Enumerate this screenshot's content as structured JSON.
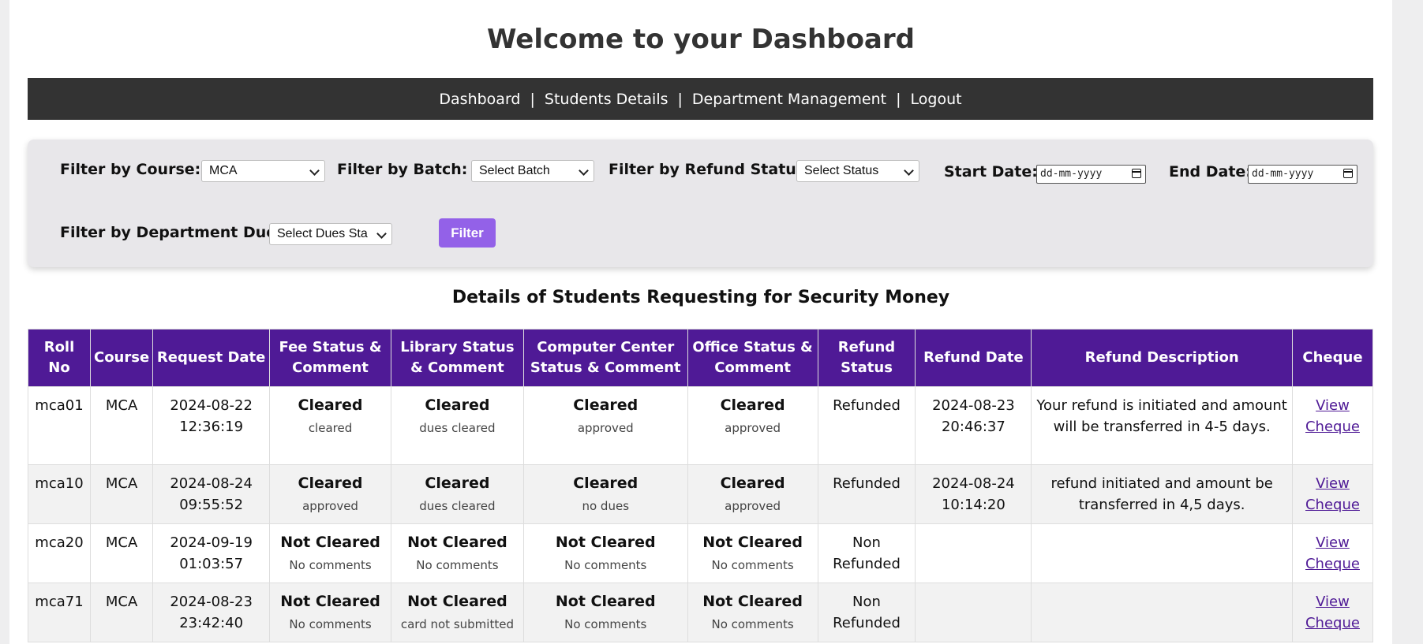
{
  "header": {
    "title": "Welcome to your Dashboard"
  },
  "nav": {
    "items": [
      "Dashboard",
      "Students Details",
      "Department Management",
      "Logout"
    ],
    "separator": "|"
  },
  "filters": {
    "course": {
      "label": "Filter by Course:",
      "value": "MCA"
    },
    "batch": {
      "label": "Filter by Batch:",
      "value": "Select Batch"
    },
    "refund_status": {
      "label": "Filter by Refund Status:",
      "value": "Select Status"
    },
    "start_date": {
      "label": "Start Date:",
      "placeholder": "dd-mm-yyyy"
    },
    "end_date": {
      "label": "End Date:",
      "placeholder": "dd-mm-yyyy"
    },
    "dues": {
      "label": "Filter by Department Dues:",
      "value": "Select Dues Sta"
    },
    "button_label": "Filter"
  },
  "section_title": "Details of Students Requesting for Security Money",
  "table": {
    "headers": [
      "Roll No",
      "Course",
      "Request Date",
      "Fee Status & Comment",
      "Library Status & Comment",
      "Computer Center Status & Comment",
      "Office Status & Comment",
      "Refund Status",
      "Refund Date",
      "Refund Description",
      "Cheque"
    ],
    "rows": [
      {
        "roll": "mca01",
        "course": "MCA",
        "request_date": "2024-08-22 12:36:19",
        "fee": {
          "status": "Cleared",
          "comment": "cleared"
        },
        "library": {
          "status": "Cleared",
          "comment": "dues cleared"
        },
        "computer": {
          "status": "Cleared",
          "comment": "approved"
        },
        "office": {
          "status": "Cleared",
          "comment": "approved"
        },
        "refund_status": "Refunded",
        "refund_date": "2024-08-23 20:46:37",
        "description": "Your refund is initiated and amount will be transferred in 4-5 days.",
        "cheque": "View Cheque"
      },
      {
        "roll": "mca10",
        "course": "MCA",
        "request_date": "2024-08-24 09:55:52",
        "fee": {
          "status": "Cleared",
          "comment": "approved"
        },
        "library": {
          "status": "Cleared",
          "comment": "dues cleared"
        },
        "computer": {
          "status": "Cleared",
          "comment": "no dues"
        },
        "office": {
          "status": "Cleared",
          "comment": "approved"
        },
        "refund_status": "Refunded",
        "refund_date": "2024-08-24 10:14:20",
        "description": "refund initiated and amount be transferred in 4,5 days.",
        "cheque": "View Cheque"
      },
      {
        "roll": "mca20",
        "course": "MCA",
        "request_date": "2024-09-19 01:03:57",
        "fee": {
          "status": "Not Cleared",
          "comment": "No comments"
        },
        "library": {
          "status": "Not Cleared",
          "comment": "No comments"
        },
        "computer": {
          "status": "Not Cleared",
          "comment": "No comments"
        },
        "office": {
          "status": "Not Cleared",
          "comment": "No comments"
        },
        "refund_status": "Non Refunded",
        "refund_date": "",
        "description": "",
        "cheque": "View Cheque"
      },
      {
        "roll": "mca71",
        "course": "MCA",
        "request_date": "2024-08-23 23:42:40",
        "fee": {
          "status": "Not Cleared",
          "comment": "No comments"
        },
        "library": {
          "status": "Not Cleared",
          "comment": "card not submitted"
        },
        "computer": {
          "status": "Not Cleared",
          "comment": "No comments"
        },
        "office": {
          "status": "Not Cleared",
          "comment": "No comments"
        },
        "refund_status": "Non Refunded",
        "refund_date": "",
        "description": "",
        "cheque": "View Cheque"
      }
    ]
  },
  "colors": {
    "nav_bg": "#333333",
    "table_header": "#4f1a96",
    "button": "#9361e8",
    "filter_panel": "#e8e7ea"
  }
}
